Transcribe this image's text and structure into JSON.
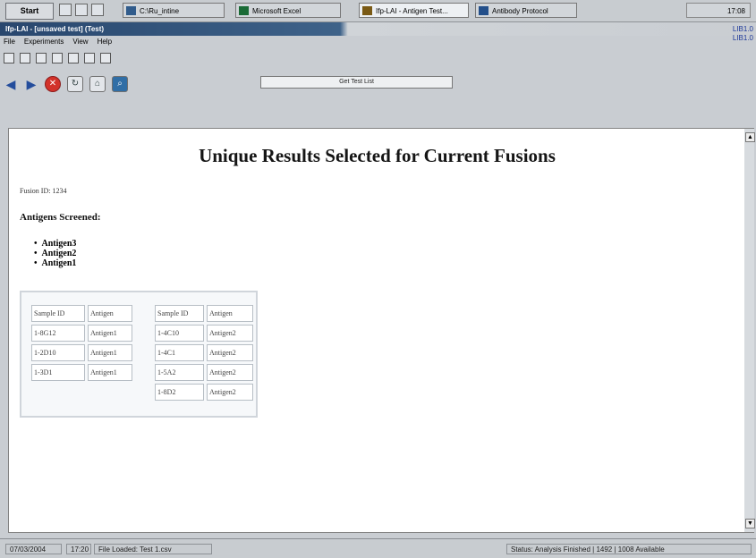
{
  "taskbar": {
    "start_label": "Start",
    "tasks": [
      {
        "label": "C:\\Ru_intine"
      },
      {
        "label": "Microsoft Excel"
      },
      {
        "label": "Ifp-LAI - Antigen Test..."
      },
      {
        "label": "Antibody Protocol"
      }
    ],
    "clock": "17:08"
  },
  "window": {
    "title": "Ifp-LAI - [unsaved test] (Test)",
    "menus": [
      "File",
      "Experiments",
      "View",
      "Help"
    ],
    "right_info": [
      "LIB1.0",
      "LIB1.0"
    ]
  },
  "toolbar": {
    "address_label": "Get Test List"
  },
  "page": {
    "title": "Unique Results Selected for Current Fusions",
    "fusion_id": "Fusion ID: 1234",
    "antigens_heading": "Antigens Screened:",
    "antigens": [
      "Antigen3",
      "Antigen2",
      "Antigen1"
    ],
    "table_headers": [
      "Sample ID",
      "Antigen"
    ],
    "table_left": [
      {
        "sample": "1-8G12",
        "antigen": "Antigen1"
      },
      {
        "sample": "1-2D10",
        "antigen": "Antigen1"
      },
      {
        "sample": "1-3D1",
        "antigen": "Antigen1"
      }
    ],
    "table_right": [
      {
        "sample": "1-4C10",
        "antigen": "Antigen2"
      },
      {
        "sample": "1-4C1",
        "antigen": "Antigen2"
      },
      {
        "sample": "1-5A2",
        "antigen": "Antigen2"
      },
      {
        "sample": "1-8D2",
        "antigen": "Antigen2"
      }
    ]
  },
  "status": {
    "date": "07/03/2004",
    "time": "17:20",
    "message": "File Loaded: Test 1.csv",
    "right": "Status: Analysis Finished | 1492 | 1008 Available"
  }
}
